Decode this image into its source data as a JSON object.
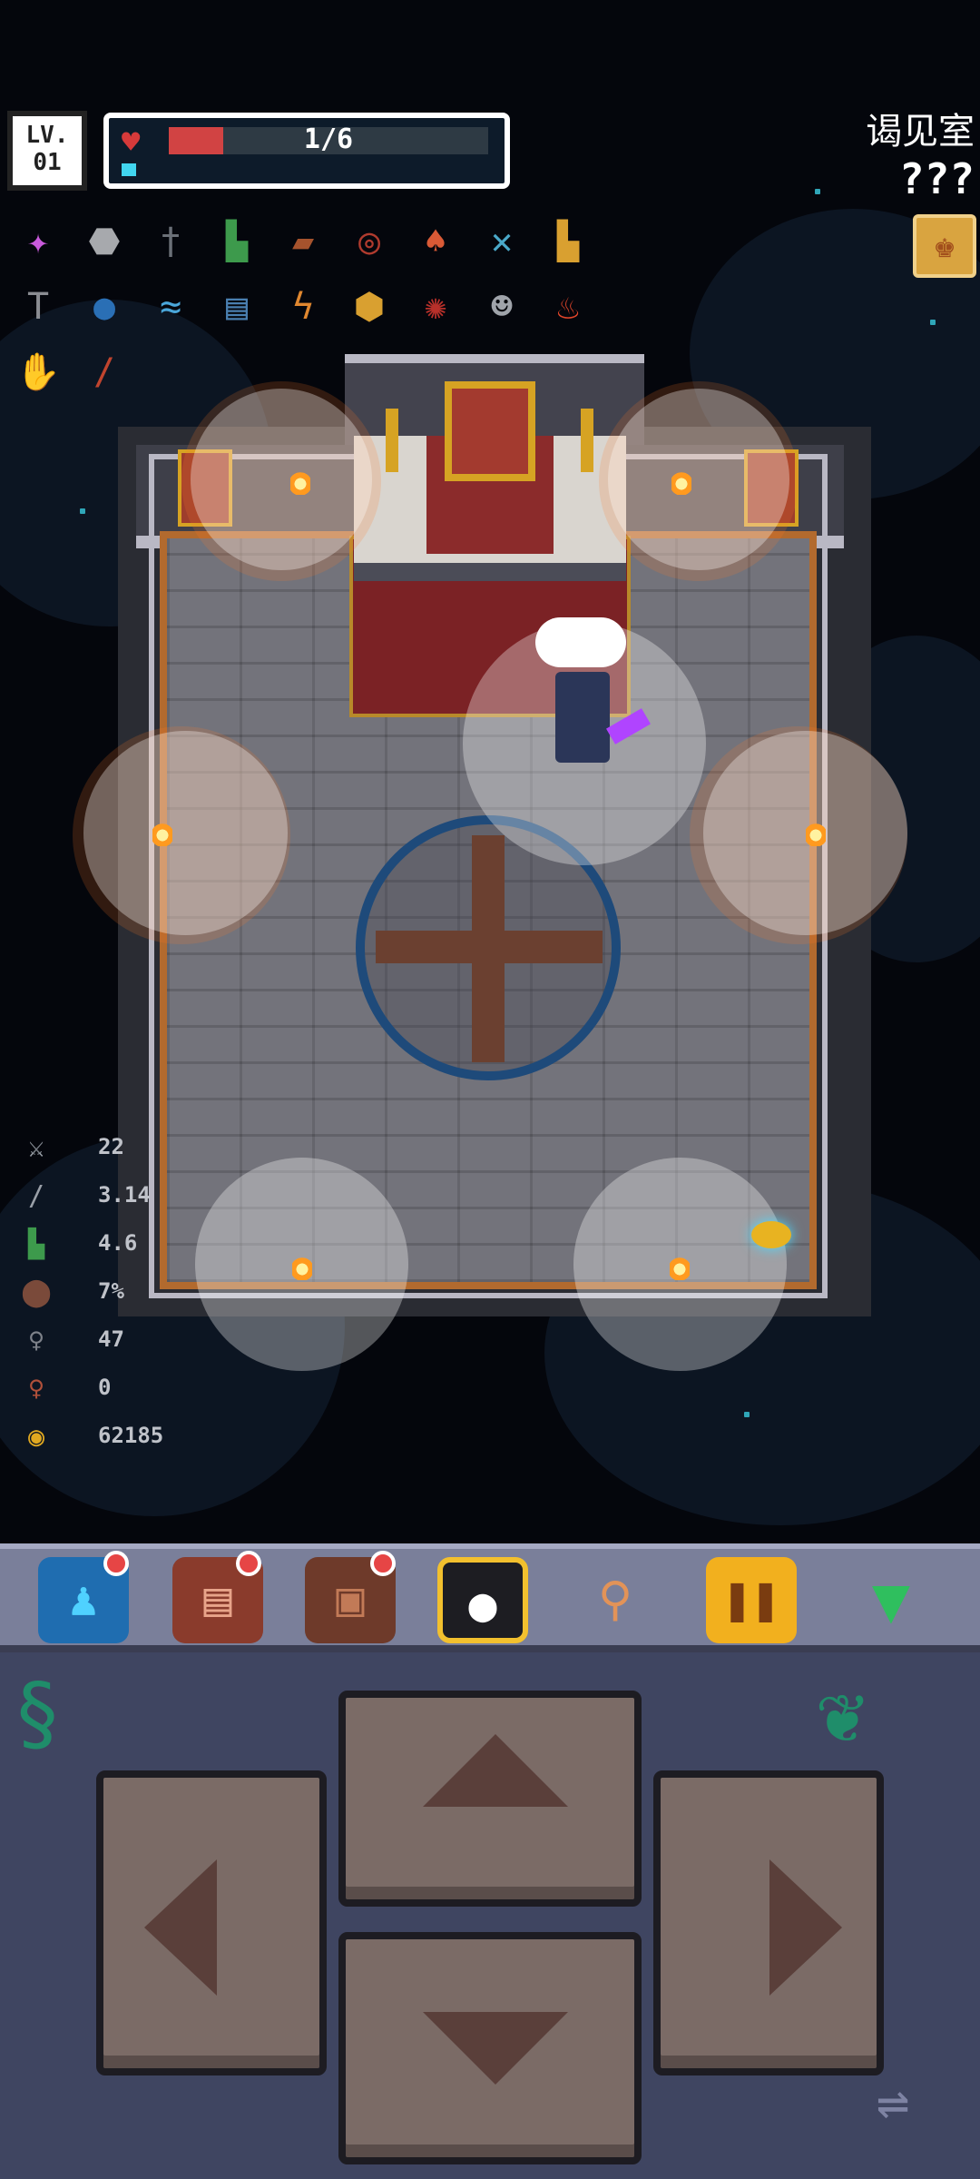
{
  "hud": {
    "level_label": "LV.",
    "level_value": "01",
    "hp_text": "1/6",
    "hp_fraction": 0.17,
    "room_name": "谒见室",
    "room_sub": "???"
  },
  "items_row1": [
    "magic-stars-icon",
    "stone-icon",
    "dagger-icon",
    "boot-green-icon",
    "wood-log-icon",
    "red-ring-icon",
    "mushroom-icon",
    "crossed-blue-icon",
    "boot-gold-icon"
  ],
  "items_row2": [
    "hammer-icon",
    "blue-orb-icon",
    "fish-icon",
    "spellbook-icon",
    "lightning-icon",
    "gold-nugget-icon",
    "red-sigil-icon",
    "skull-mask-icon",
    "flame-icon"
  ],
  "items_row3": [
    "gauntlet-icon",
    "red-wand-icon"
  ],
  "stats": [
    {
      "icon": "crossed-swords-icon",
      "value": "22"
    },
    {
      "icon": "sword-speed-icon",
      "value": "3.14"
    },
    {
      "icon": "boot-icon",
      "value": "4.6"
    },
    {
      "icon": "shield-icon",
      "value": "7%"
    },
    {
      "icon": "key-icon",
      "value": "47"
    },
    {
      "icon": "red-key-icon",
      "value": "0"
    },
    {
      "icon": "gold-coin-icon",
      "value": "62185"
    }
  ],
  "colors": {
    "hp": "#d14343",
    "mp": "#41d6ef",
    "panel": "#3f4561",
    "toolbar": "#7a7f9a"
  }
}
